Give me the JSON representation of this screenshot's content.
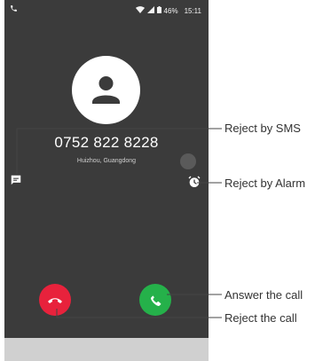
{
  "status_bar": {
    "battery": "46%",
    "time": "15:11"
  },
  "caller": {
    "number": "0752 822 8228",
    "location": "Huizhou, Guangdong"
  },
  "icons": {
    "status_phone": "phone-icon",
    "sms": "message-icon",
    "alarm": "alarm-clock-icon",
    "answer": "phone-answer-icon",
    "reject": "phone-hangup-icon",
    "avatar": "person-icon"
  },
  "colors": {
    "reject": "#e8223c",
    "answer": "#25b14a",
    "screen_bg": "#3b3b3b"
  },
  "callouts": {
    "reject_sms": "Reject by SMS",
    "reject_alarm": "Reject by Alarm",
    "answer_call": "Answer the call",
    "reject_call": "Reject the call"
  }
}
